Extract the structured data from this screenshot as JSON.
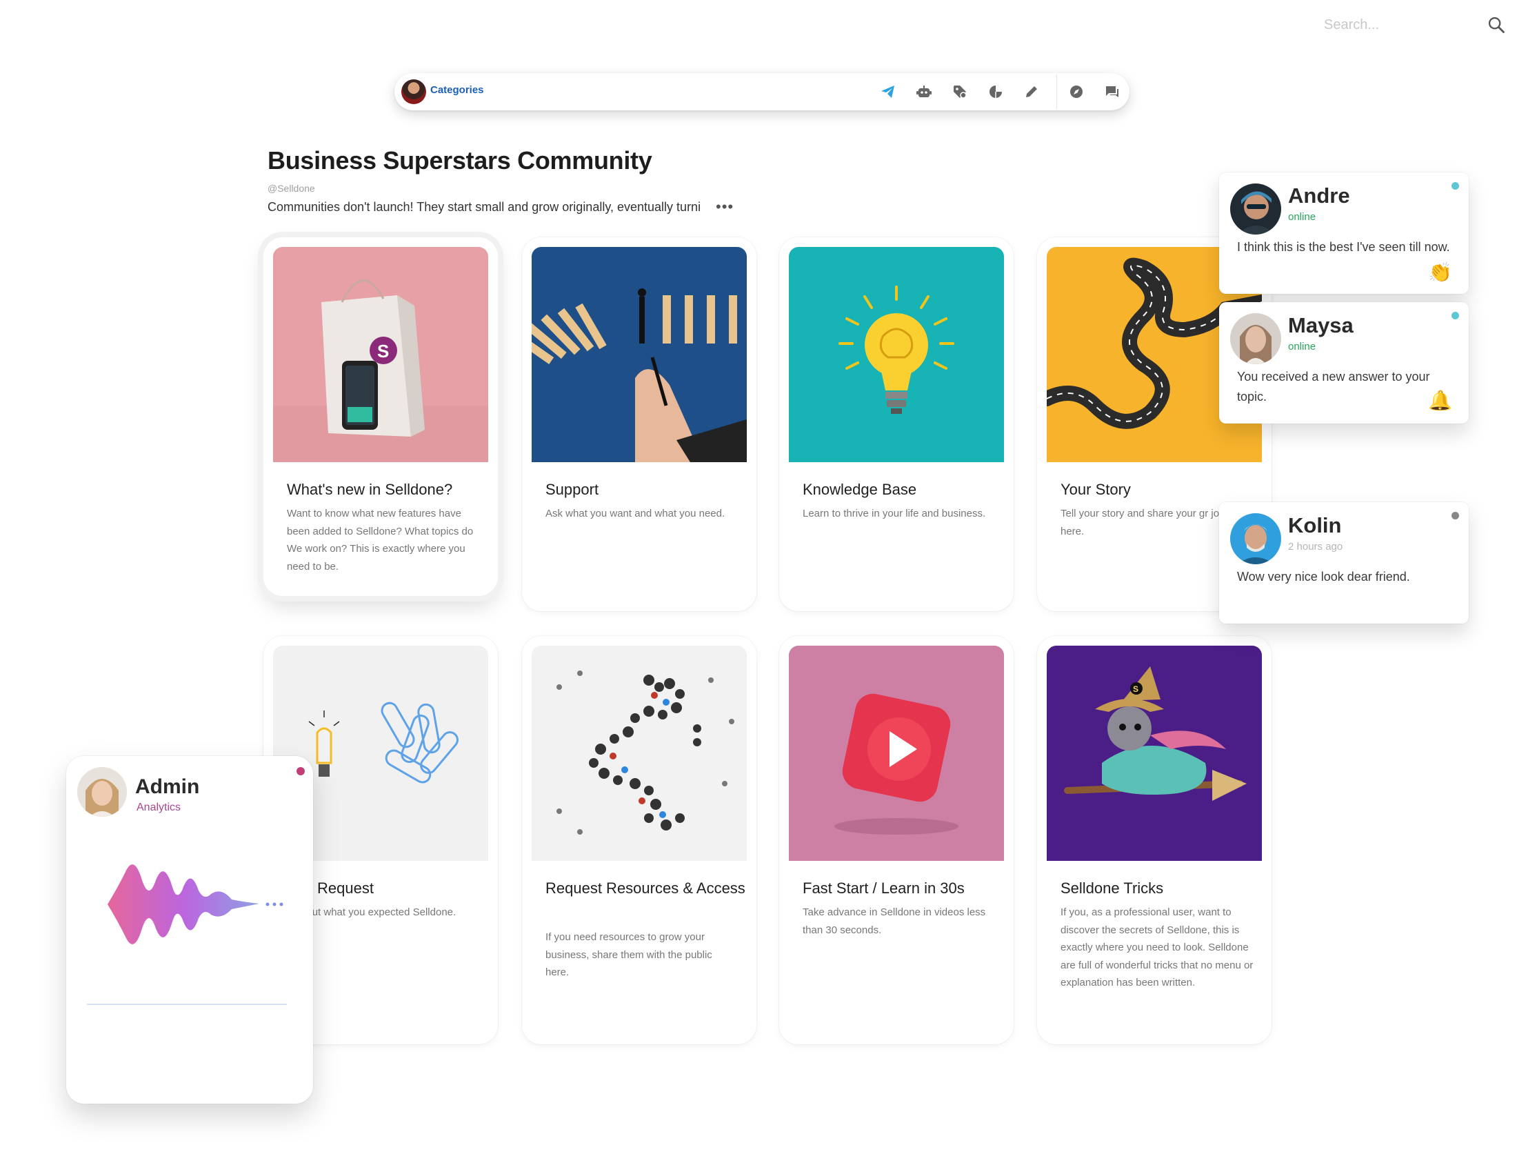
{
  "search": {
    "placeholder": "Search..."
  },
  "topbar": {
    "categories_label": "Categories"
  },
  "community": {
    "title": "Business Superstars Community",
    "handle": "@Selldone",
    "description": "Communities don't launch! They start small and grow originally, eventually turni"
  },
  "cards": [
    {
      "title": "What's new in Selldone?",
      "description": "Want to know what new features have been added to Selldone? What topics do We work on? This is exactly where you need to be."
    },
    {
      "title": "Support",
      "description": "Ask what you want and what you need."
    },
    {
      "title": "Knowledge Base",
      "description": "Learn to thrive in your life and business."
    },
    {
      "title": "Your Story",
      "description": "Tell your story and share your gr journey here."
    },
    {
      "title": "ture Request",
      "description": "s about what you expected Selldone."
    },
    {
      "title": "Request Resources & Access",
      "description": "If you need resources to grow your business, share them with the public here."
    },
    {
      "title": "Fast Start / Learn in 30s",
      "description": "Take advance in Selldone in videos less than 30 seconds."
    },
    {
      "title": "Selldone Tricks",
      "description": "If you, as a professional user, want to discover the secrets of Selldone, this is exactly where you need to look. Selldone are full of wonderful tricks that no menu or explanation has been written."
    }
  ],
  "chats": [
    {
      "name": "Andre",
      "status": "online",
      "message": "I think this is the best I've seen till now.",
      "emoji": "👏"
    },
    {
      "name": "Maysa",
      "status": "online",
      "message": "You received a new answer to your topic.",
      "emoji": "🔔"
    },
    {
      "name": "Kolin",
      "status": "2 hours ago",
      "message": "Wow very nice look dear friend."
    }
  ],
  "admin": {
    "name": "Admin",
    "role": "Analytics"
  },
  "colors": {
    "accent": "#1c5fb8",
    "online": "#26a65b",
    "admin_role": "#a9458e",
    "telegram": "#2aa3df"
  }
}
